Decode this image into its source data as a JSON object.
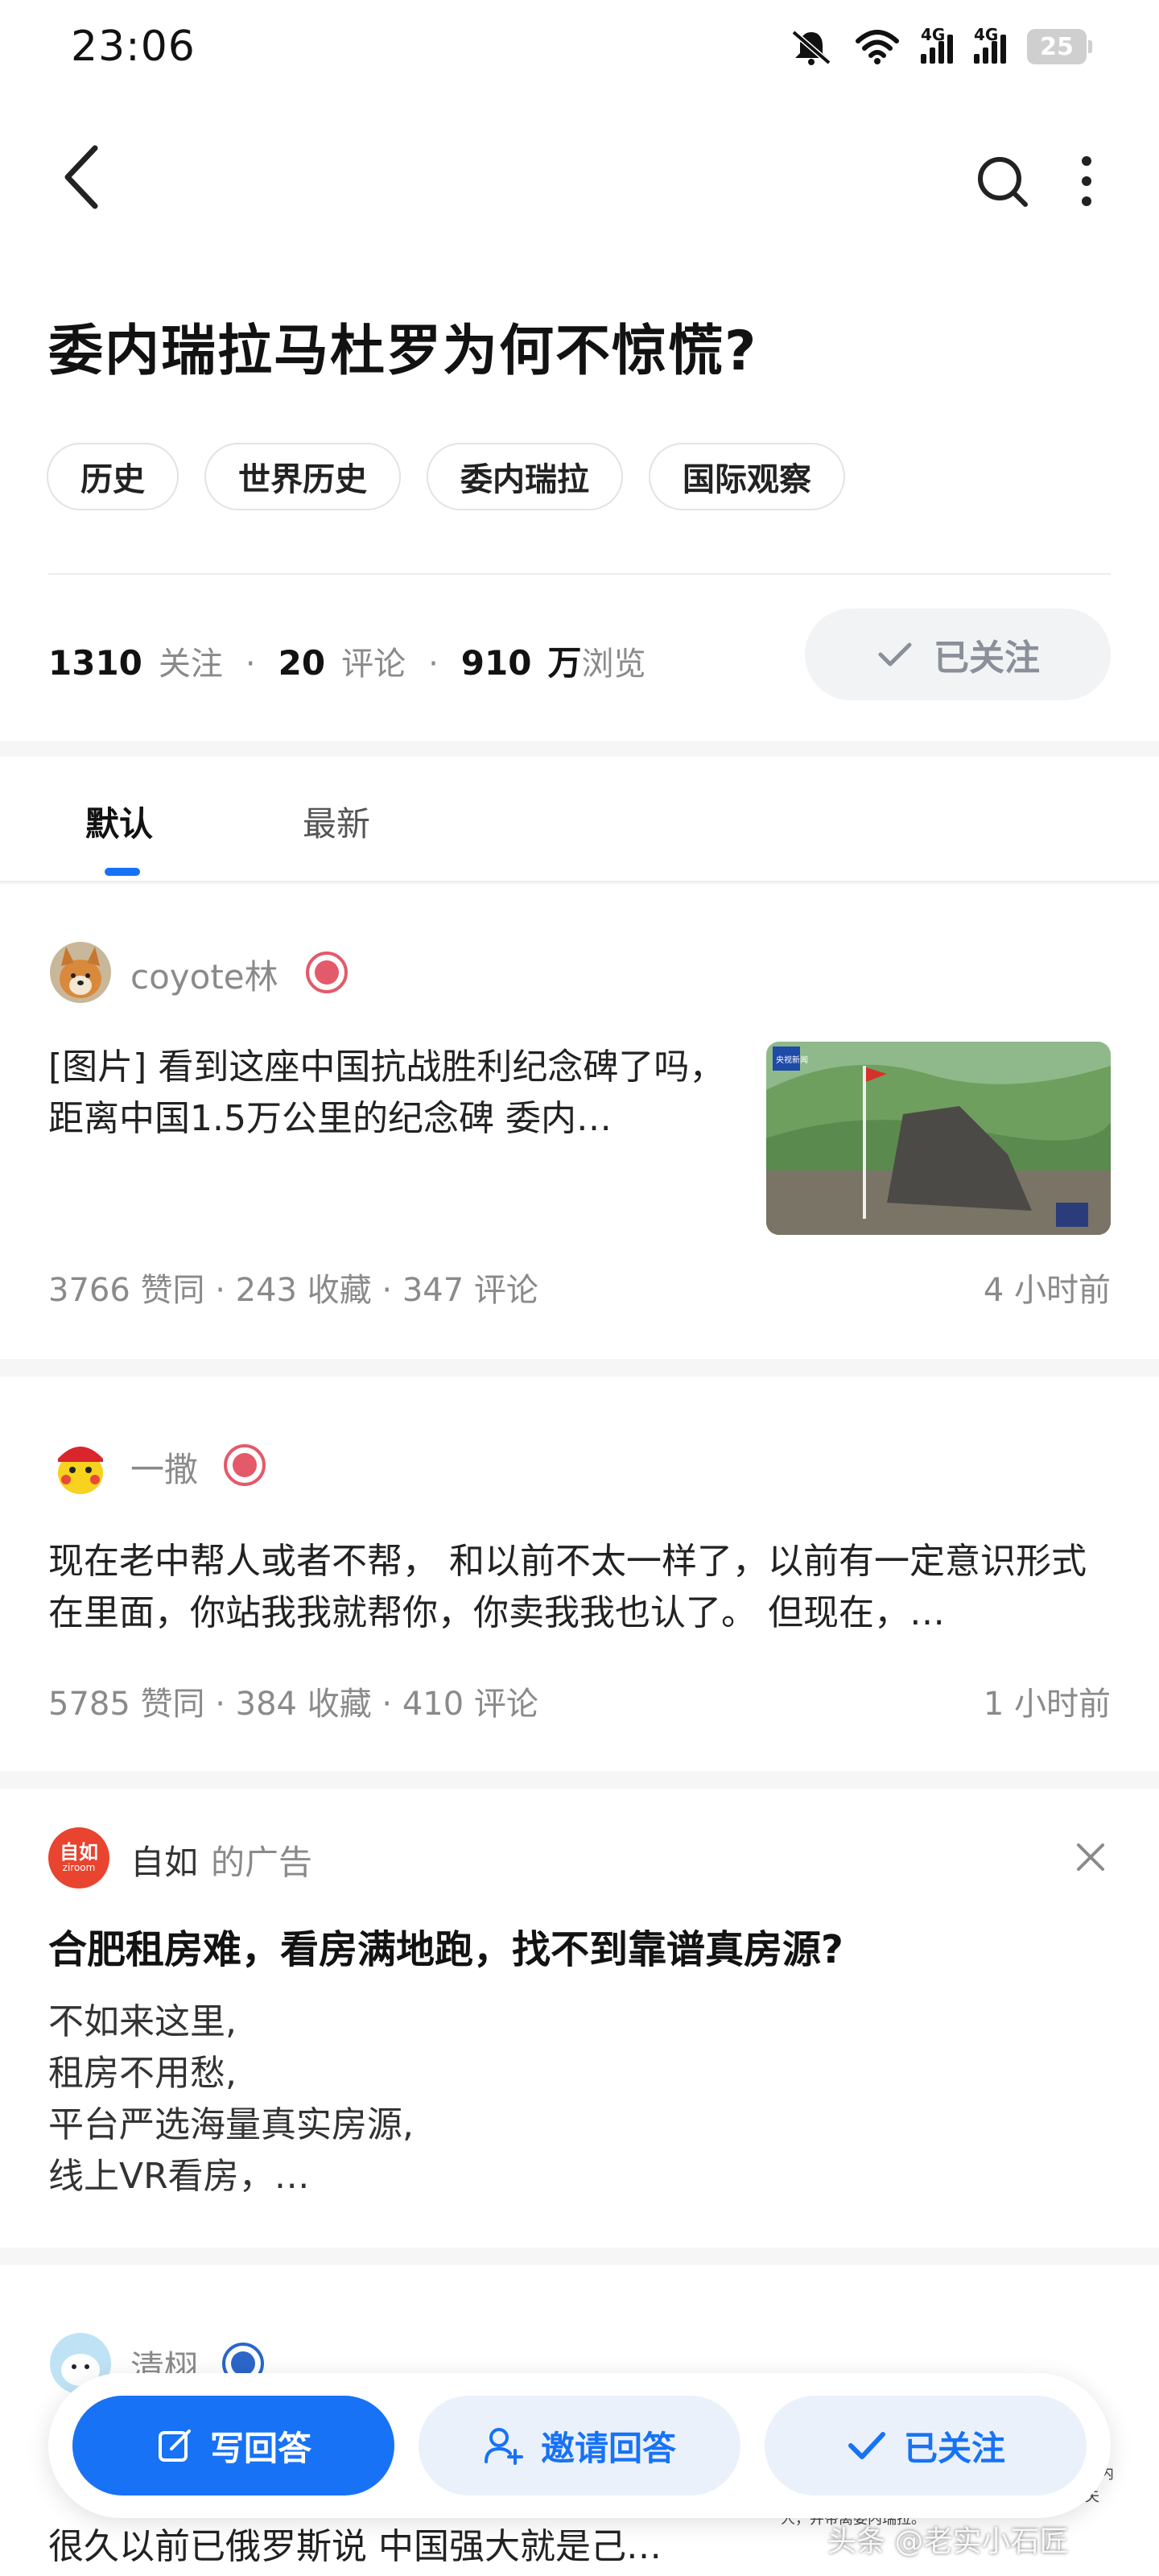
{
  "status": {
    "time": "23:06",
    "battery": "25",
    "net1": "4G",
    "net2": "4G"
  },
  "question": {
    "title": "委内瑞拉马杜罗为何不惊慌?",
    "tags": [
      "历史",
      "世界历史",
      "委内瑞拉",
      "国际观察"
    ],
    "followers": "1310",
    "followers_label": "关注",
    "comments": "20",
    "comments_label": "评论",
    "views": "910",
    "views_unit": "万",
    "views_label": "浏览",
    "followed_label": "已关注"
  },
  "tabs": [
    "默认",
    "最新"
  ],
  "answers": [
    {
      "author": "coyote林",
      "excerpt": "[图片] 看到这座中国抗战胜利纪念碑了吗，距离中国1.5万公里的纪念碑 委内…",
      "meta": "3766 赞同 · 243 收藏 · 347 评论",
      "time": "4 小时前",
      "thumb_badge": "央视新闻"
    },
    {
      "author": "一撒",
      "excerpt": "现在老中帮人或者不帮， 和以前不太一样了，以前有一定意识形式在里面，你站我我就帮你，你卖我我也认了。 但现在，…",
      "meta": "5785 赞同 · 384 收藏 · 410 评论",
      "time": "1 小时前"
    }
  ],
  "ad": {
    "logo": "自如",
    "logo_sub": "ziroom",
    "name": "自如",
    "suffix": "的广告",
    "title": "合肥租房难，看房满地跑，找不到靠谱真房源?",
    "lines": [
      "不如来这里,",
      "租房不用愁,",
      "平台严选海量真实房源,",
      "线上VR看房，…"
    ]
  },
  "next_answer": {
    "author": "清栩",
    "excerpt": "很久以前已俄罗斯说 中国强大就是己…"
  },
  "actions": {
    "write": "写回答",
    "invite": "邀请回答",
    "followed": "已关注"
  },
  "watermark": "头条 @老实小石匠",
  "news_snip": "新华社快讯：美国总统特朗普称，美方已成功对委内瑞拉实施大规模打击，委内瑞拉总统马杜罗及其夫人，并带离委内瑞拉。",
  "colors": {
    "accent": "#1772f6",
    "badge": "#e35a6a",
    "ad_logo": "#e8442f"
  }
}
